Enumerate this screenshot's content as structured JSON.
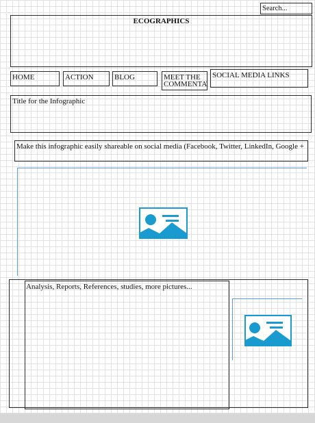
{
  "search": {
    "label": "Search..."
  },
  "header": {
    "title": "ECOGRAPHICS"
  },
  "nav": {
    "home": "HOME",
    "action": "ACTION",
    "blog": "BLOG",
    "meet_line1": "MEET THE",
    "meet_line2": "COMMENTAT",
    "social": "SOCIAL MEDIA LINKS"
  },
  "infographic": {
    "title": "Title for the Infographic",
    "share_text": "Make this infographic easily shareable on social media (Facebook, Twitter, LinkedIn, Google +"
  },
  "analysis": {
    "text": "Analysis, Reports, References, studies, more pictures..."
  },
  "colors": {
    "placeholder_blue": "#1a9bd0",
    "guide_blue": "#5b9be0"
  }
}
